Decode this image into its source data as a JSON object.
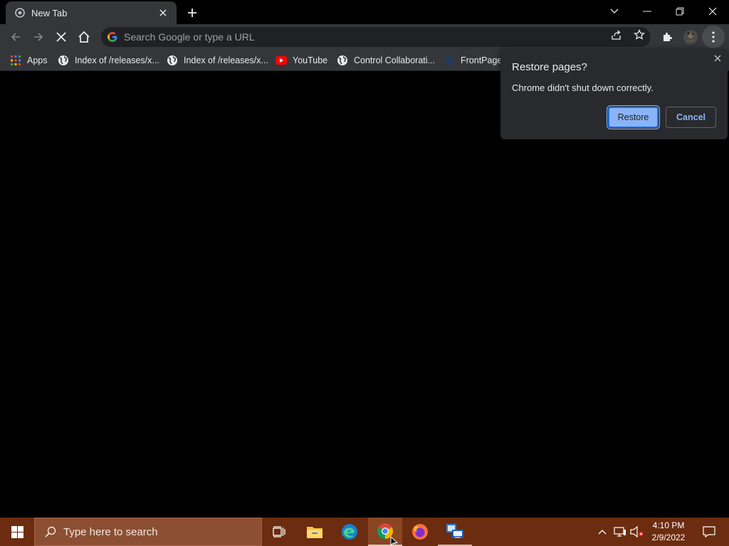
{
  "browser": {
    "tab": {
      "title": "New Tab"
    },
    "omnibox": {
      "placeholder": "Search Google or type a URL"
    },
    "bookmarks": [
      {
        "label": "Apps",
        "icon": "apps-grid-icon"
      },
      {
        "label": "Index of /releases/x...",
        "icon": "globe-icon"
      },
      {
        "label": "Index of /releases/x...",
        "icon": "globe-icon"
      },
      {
        "label": "YouTube",
        "icon": "youtube-icon"
      },
      {
        "label": "Control Collaborati...",
        "icon": "globe-icon"
      },
      {
        "label": "FrontPage",
        "icon": "frontpage-icon"
      }
    ]
  },
  "restore_bubble": {
    "title": "Restore pages?",
    "message": "Chrome didn't shut down correctly.",
    "restore_label": "Restore",
    "cancel_label": "Cancel"
  },
  "taskbar": {
    "search_placeholder": "Type here to search",
    "time": "4:10 PM",
    "date": "2/9/2022"
  },
  "colors": {
    "taskbar_bg": "#6b2c0f",
    "chrome_toolbar": "#35363a",
    "accent_blue": "#8ab4f8"
  }
}
